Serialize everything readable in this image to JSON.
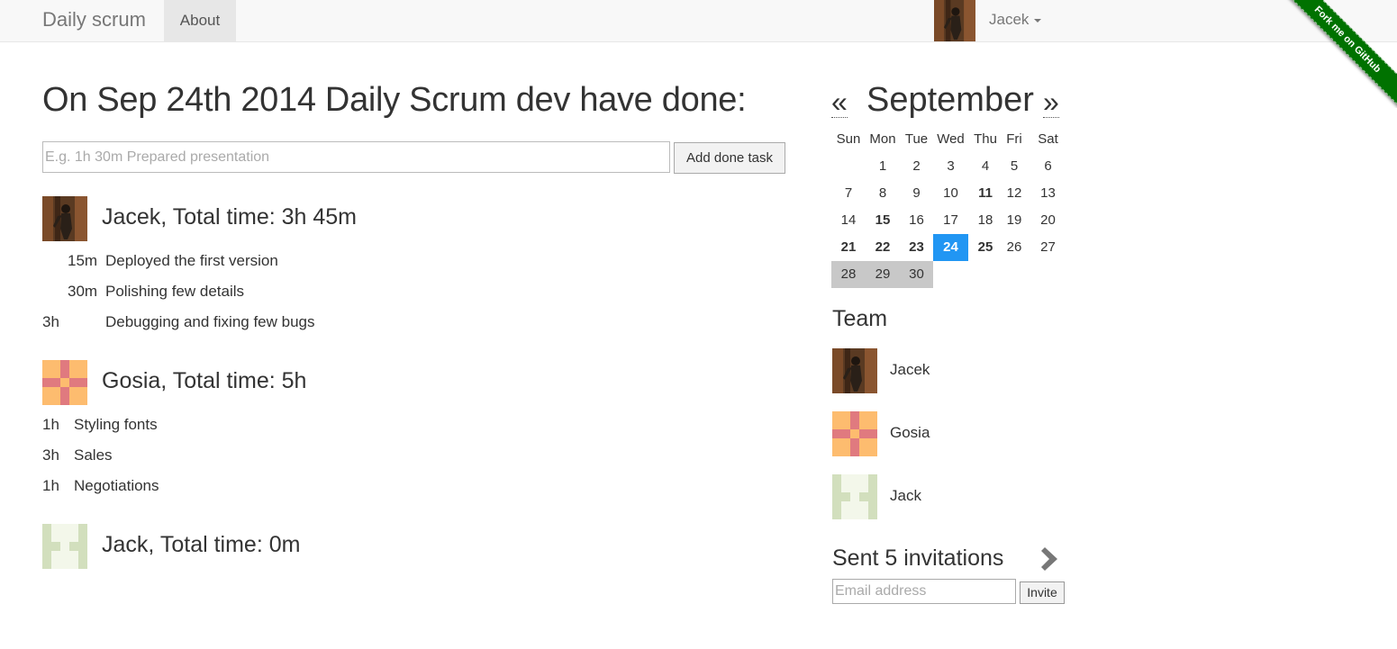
{
  "navbar": {
    "brand": "Daily scrum",
    "about": "About",
    "user": "Jacek",
    "ribbon": "Fork me on GitHub"
  },
  "main": {
    "heading": "On Sep 24th 2014 Daily Scrum dev have done:",
    "task_placeholder": "E.g. 1h 30m Prepared presentation",
    "add_button": "Add done task",
    "members": [
      {
        "title": "Jacek, Total time: 3h 45m",
        "avatar": "photo-avatar",
        "tasks": [
          {
            "time": "15m",
            "desc": "Deployed the first version"
          },
          {
            "time": "30m",
            "desc": "Polishing few details"
          },
          {
            "time": "3h",
            "desc": "Debugging and fixing few bugs"
          }
        ]
      },
      {
        "title": "Gosia, Total time: 5h",
        "avatar": "identicon-orange",
        "tasks": [
          {
            "time": "1h",
            "desc": "Styling fonts"
          },
          {
            "time": "3h",
            "desc": "Sales"
          },
          {
            "time": "1h",
            "desc": "Negotiations"
          }
        ]
      },
      {
        "title": "Jack, Total time: 0m",
        "avatar": "identicon-green",
        "tasks": []
      }
    ]
  },
  "calendar": {
    "prev": "«",
    "next": "»",
    "month": "September",
    "weekdays": [
      "Sun",
      "Mon",
      "Tue",
      "Wed",
      "Thu",
      "Fri",
      "Sat"
    ],
    "weeks": [
      [
        "",
        "1",
        "2",
        "3",
        "4",
        "5",
        "6"
      ],
      [
        "7",
        "8",
        "9",
        "10",
        "11",
        "12",
        "13"
      ],
      [
        "14",
        "15",
        "16",
        "17",
        "18",
        "19",
        "20"
      ],
      [
        "21",
        "22",
        "23",
        "24",
        "25",
        "26",
        "27"
      ],
      [
        "28",
        "29",
        "30",
        "",
        "",
        "",
        ""
      ]
    ],
    "bold_days": [
      "11",
      "15",
      "21",
      "22",
      "23",
      "25"
    ],
    "today": "24",
    "greyed_days": [
      "28",
      "29",
      "30"
    ],
    "today_color": "#2196f3"
  },
  "team": {
    "title": "Team",
    "members": [
      "Jacek",
      "Gosia",
      "Jack"
    ]
  },
  "invitations": {
    "title": "Sent 5 invitations",
    "email_placeholder": "Email address",
    "invite_button": "Invite"
  },
  "colors": {
    "identicon_orange": "#fdbc6f",
    "identicon_red": "#e07a7f",
    "identicon_green": "#d2dfbd",
    "ribbon": "#007200"
  }
}
